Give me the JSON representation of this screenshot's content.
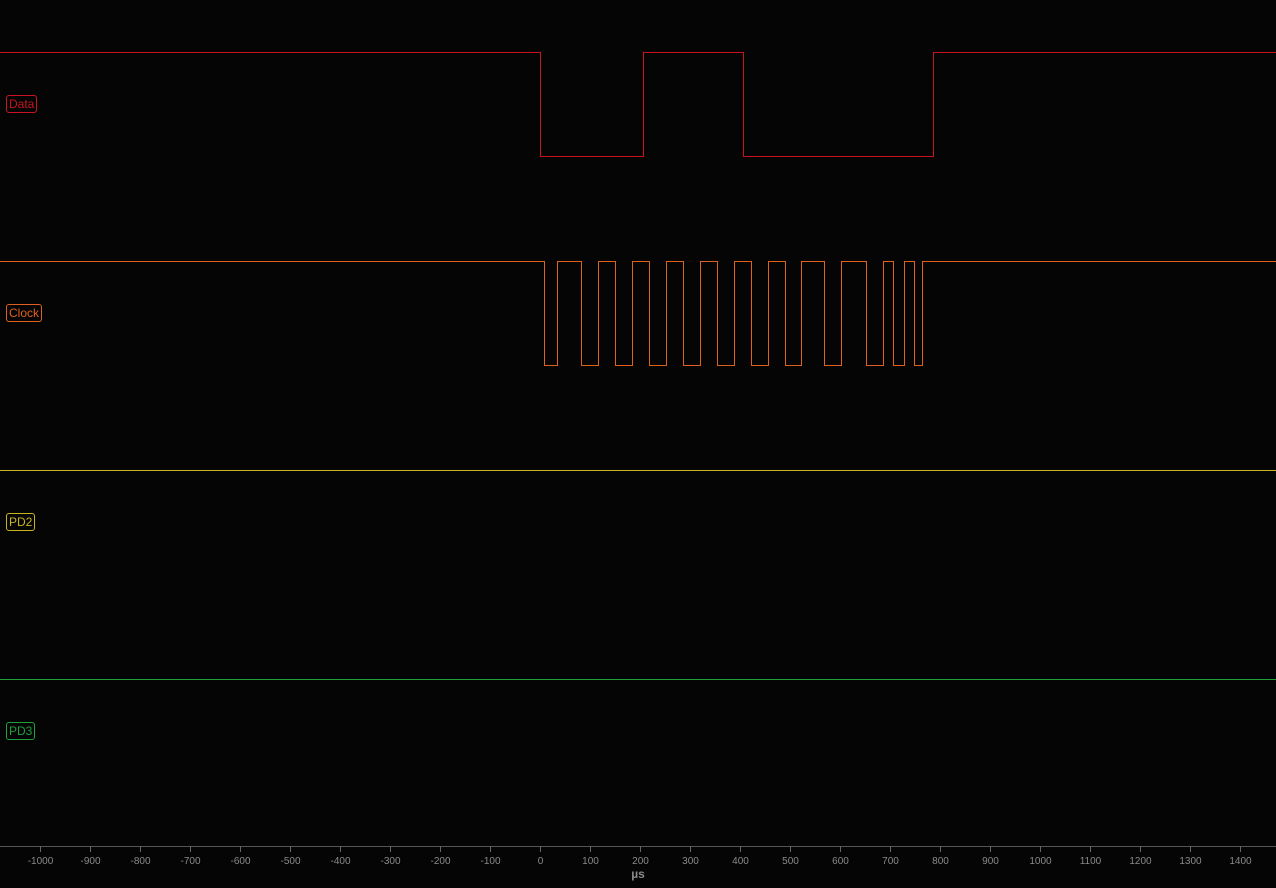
{
  "viewer": {
    "background": "#050505",
    "axis_color": "#8a8a8a"
  },
  "channels": [
    {
      "name": "Data",
      "color": "#c8141e",
      "initial_level": 1,
      "edges": [
        0,
        205,
        407,
        785
      ]
    },
    {
      "name": "Clock",
      "color": "#e0601e",
      "initial_level": 1,
      "edges": [
        7,
        34,
        82,
        116,
        150,
        184,
        218,
        252,
        286,
        320,
        354,
        388,
        422,
        456,
        490,
        522,
        568,
        602,
        652,
        686,
        707,
        728,
        748,
        764
      ]
    },
    {
      "name": "PD2",
      "color": "#c8b41e",
      "initial_level": 1,
      "edges": []
    },
    {
      "name": "PD3",
      "color": "#1ea03c",
      "initial_level": 1,
      "edges": []
    }
  ],
  "axis": {
    "unit": "µs",
    "min": -1080,
    "max": 1472,
    "tick_step": 100,
    "ticks": [
      "-1000",
      "-900",
      "-800",
      "-700",
      "-600",
      "-500",
      "-400",
      "-300",
      "-200",
      "-100",
      "0",
      "100",
      "200",
      "300",
      "400",
      "500",
      "600",
      "700",
      "800",
      "900",
      "1000",
      "1100",
      "1200",
      "1300",
      "1400"
    ]
  }
}
